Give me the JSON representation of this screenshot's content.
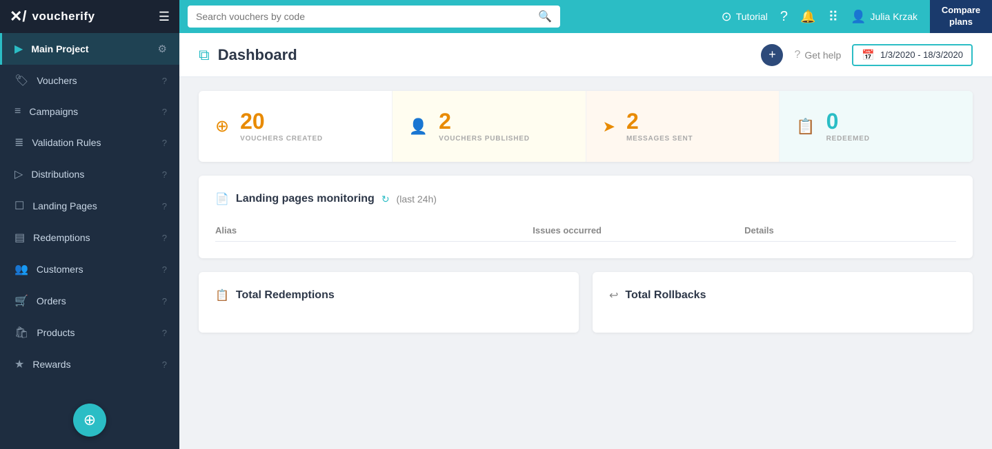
{
  "topnav": {
    "logo_icon": "✕/",
    "logo_text": "voucherify",
    "search_placeholder": "Search vouchers by code",
    "tutorial_label": "Tutorial",
    "user_name": "Julia Krzak",
    "compare_label": "Compare\nplans"
  },
  "sidebar": {
    "items": [
      {
        "id": "main-project",
        "label": "Main Project",
        "icon": "▶",
        "active": true,
        "has_gear": true
      },
      {
        "id": "vouchers",
        "label": "Vouchers",
        "icon": "🏷",
        "active": false,
        "has_gear": false
      },
      {
        "id": "campaigns",
        "label": "Campaigns",
        "icon": "≡",
        "active": false,
        "has_gear": false
      },
      {
        "id": "validation-rules",
        "label": "Validation Rules",
        "icon": "≣",
        "active": false,
        "has_gear": false
      },
      {
        "id": "distributions",
        "label": "Distributions",
        "icon": "▷",
        "active": false,
        "has_gear": false
      },
      {
        "id": "landing-pages",
        "label": "Landing Pages",
        "icon": "☐",
        "active": false,
        "has_gear": false
      },
      {
        "id": "redemptions",
        "label": "Redemptions",
        "icon": "≡",
        "active": false,
        "has_gear": false
      },
      {
        "id": "customers",
        "label": "Customers",
        "icon": "👥",
        "active": false,
        "has_gear": false
      },
      {
        "id": "orders",
        "label": "Orders",
        "icon": "🛒",
        "active": false,
        "has_gear": false
      },
      {
        "id": "products",
        "label": "Products",
        "icon": "🛍",
        "active": false,
        "has_gear": false
      },
      {
        "id": "rewards",
        "label": "Rewards",
        "icon": "★",
        "active": false,
        "has_gear": false
      }
    ],
    "fab_icon": "🔧"
  },
  "header": {
    "title": "Dashboard",
    "get_help": "Get help",
    "date_range": "1/3/2020 - 18/3/2020"
  },
  "stats": [
    {
      "number": "20",
      "label": "VOUCHERS CREATED",
      "icon": "➕",
      "color": "orange",
      "bg": ""
    },
    {
      "number": "2",
      "label": "VOUCHERS PUBLISHED",
      "icon": "👤",
      "color": "orange",
      "bg": "bg-cream"
    },
    {
      "number": "2",
      "label": "MESSAGES SENT",
      "icon": "➤",
      "color": "orange",
      "bg": "bg-peach"
    },
    {
      "number": "0",
      "label": "REDEEMED",
      "icon": "📋",
      "color": "teal",
      "bg": "bg-teal"
    }
  ],
  "monitoring": {
    "title": "Landing pages monitoring",
    "subtitle": "(last 24h)",
    "columns": [
      "Alias",
      "Issues occurred",
      "Details"
    ]
  },
  "bottom_cards": [
    {
      "title": "Total Redemptions"
    },
    {
      "title": "Total Rollbacks"
    }
  ],
  "colors": {
    "accent": "#2bbdc5",
    "sidebar_bg": "#1e2d40",
    "topnav_bg": "#2bbdc5"
  }
}
